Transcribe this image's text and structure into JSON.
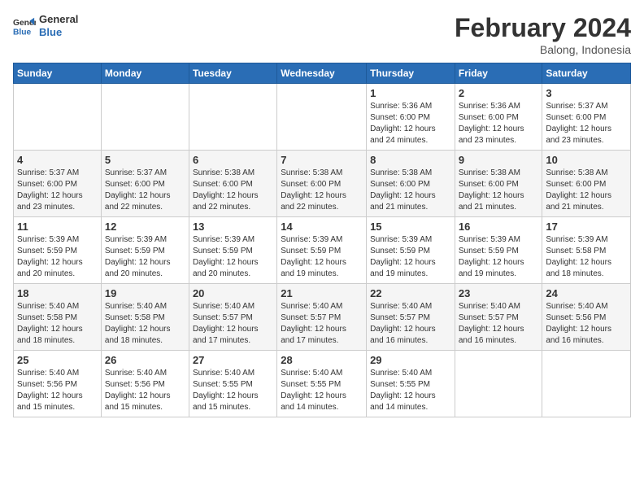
{
  "logo": {
    "name_part1": "General",
    "name_part2": "Blue"
  },
  "header": {
    "month": "February 2024",
    "location": "Balong, Indonesia"
  },
  "days_of_week": [
    "Sunday",
    "Monday",
    "Tuesday",
    "Wednesday",
    "Thursday",
    "Friday",
    "Saturday"
  ],
  "weeks": [
    [
      {
        "day": "",
        "info": ""
      },
      {
        "day": "",
        "info": ""
      },
      {
        "day": "",
        "info": ""
      },
      {
        "day": "",
        "info": ""
      },
      {
        "day": "1",
        "info": "Sunrise: 5:36 AM\nSunset: 6:00 PM\nDaylight: 12 hours\nand 24 minutes."
      },
      {
        "day": "2",
        "info": "Sunrise: 5:36 AM\nSunset: 6:00 PM\nDaylight: 12 hours\nand 23 minutes."
      },
      {
        "day": "3",
        "info": "Sunrise: 5:37 AM\nSunset: 6:00 PM\nDaylight: 12 hours\nand 23 minutes."
      }
    ],
    [
      {
        "day": "4",
        "info": "Sunrise: 5:37 AM\nSunset: 6:00 PM\nDaylight: 12 hours\nand 23 minutes."
      },
      {
        "day": "5",
        "info": "Sunrise: 5:37 AM\nSunset: 6:00 PM\nDaylight: 12 hours\nand 22 minutes."
      },
      {
        "day": "6",
        "info": "Sunrise: 5:38 AM\nSunset: 6:00 PM\nDaylight: 12 hours\nand 22 minutes."
      },
      {
        "day": "7",
        "info": "Sunrise: 5:38 AM\nSunset: 6:00 PM\nDaylight: 12 hours\nand 22 minutes."
      },
      {
        "day": "8",
        "info": "Sunrise: 5:38 AM\nSunset: 6:00 PM\nDaylight: 12 hours\nand 21 minutes."
      },
      {
        "day": "9",
        "info": "Sunrise: 5:38 AM\nSunset: 6:00 PM\nDaylight: 12 hours\nand 21 minutes."
      },
      {
        "day": "10",
        "info": "Sunrise: 5:38 AM\nSunset: 6:00 PM\nDaylight: 12 hours\nand 21 minutes."
      }
    ],
    [
      {
        "day": "11",
        "info": "Sunrise: 5:39 AM\nSunset: 5:59 PM\nDaylight: 12 hours\nand 20 minutes."
      },
      {
        "day": "12",
        "info": "Sunrise: 5:39 AM\nSunset: 5:59 PM\nDaylight: 12 hours\nand 20 minutes."
      },
      {
        "day": "13",
        "info": "Sunrise: 5:39 AM\nSunset: 5:59 PM\nDaylight: 12 hours\nand 20 minutes."
      },
      {
        "day": "14",
        "info": "Sunrise: 5:39 AM\nSunset: 5:59 PM\nDaylight: 12 hours\nand 19 minutes."
      },
      {
        "day": "15",
        "info": "Sunrise: 5:39 AM\nSunset: 5:59 PM\nDaylight: 12 hours\nand 19 minutes."
      },
      {
        "day": "16",
        "info": "Sunrise: 5:39 AM\nSunset: 5:59 PM\nDaylight: 12 hours\nand 19 minutes."
      },
      {
        "day": "17",
        "info": "Sunrise: 5:39 AM\nSunset: 5:58 PM\nDaylight: 12 hours\nand 18 minutes."
      }
    ],
    [
      {
        "day": "18",
        "info": "Sunrise: 5:40 AM\nSunset: 5:58 PM\nDaylight: 12 hours\nand 18 minutes."
      },
      {
        "day": "19",
        "info": "Sunrise: 5:40 AM\nSunset: 5:58 PM\nDaylight: 12 hours\nand 18 minutes."
      },
      {
        "day": "20",
        "info": "Sunrise: 5:40 AM\nSunset: 5:57 PM\nDaylight: 12 hours\nand 17 minutes."
      },
      {
        "day": "21",
        "info": "Sunrise: 5:40 AM\nSunset: 5:57 PM\nDaylight: 12 hours\nand 17 minutes."
      },
      {
        "day": "22",
        "info": "Sunrise: 5:40 AM\nSunset: 5:57 PM\nDaylight: 12 hours\nand 16 minutes."
      },
      {
        "day": "23",
        "info": "Sunrise: 5:40 AM\nSunset: 5:57 PM\nDaylight: 12 hours\nand 16 minutes."
      },
      {
        "day": "24",
        "info": "Sunrise: 5:40 AM\nSunset: 5:56 PM\nDaylight: 12 hours\nand 16 minutes."
      }
    ],
    [
      {
        "day": "25",
        "info": "Sunrise: 5:40 AM\nSunset: 5:56 PM\nDaylight: 12 hours\nand 15 minutes."
      },
      {
        "day": "26",
        "info": "Sunrise: 5:40 AM\nSunset: 5:56 PM\nDaylight: 12 hours\nand 15 minutes."
      },
      {
        "day": "27",
        "info": "Sunrise: 5:40 AM\nSunset: 5:55 PM\nDaylight: 12 hours\nand 15 minutes."
      },
      {
        "day": "28",
        "info": "Sunrise: 5:40 AM\nSunset: 5:55 PM\nDaylight: 12 hours\nand 14 minutes."
      },
      {
        "day": "29",
        "info": "Sunrise: 5:40 AM\nSunset: 5:55 PM\nDaylight: 12 hours\nand 14 minutes."
      },
      {
        "day": "",
        "info": ""
      },
      {
        "day": "",
        "info": ""
      }
    ]
  ]
}
